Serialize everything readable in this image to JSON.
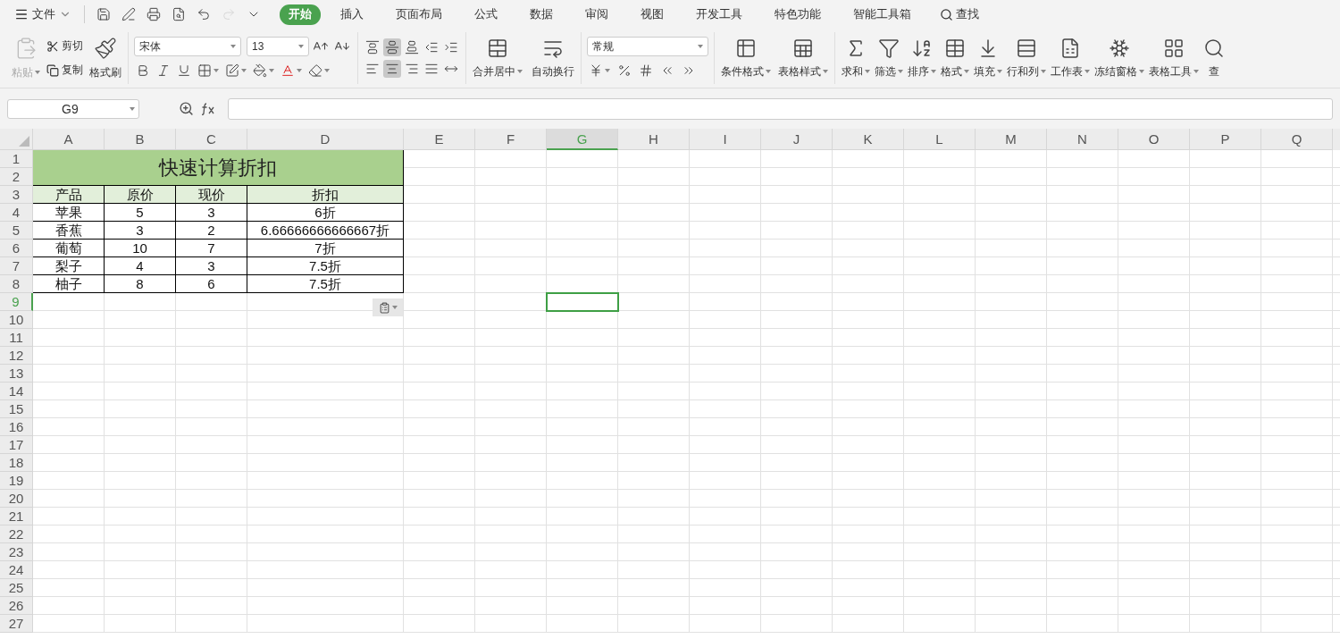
{
  "menu": {
    "label": "文件"
  },
  "quick_access": [
    {
      "disabled": false
    },
    {
      "disabled": false
    },
    {
      "disabled": false
    },
    {
      "disabled": false
    },
    {
      "disabled": false
    },
    {
      "disabled": true
    },
    {
      "disabled": false
    }
  ],
  "tabs": [
    {
      "label": "开始",
      "selected": true
    },
    {
      "label": "插入",
      "selected": false
    },
    {
      "label": "页面布局",
      "selected": false
    },
    {
      "label": "公式",
      "selected": false
    },
    {
      "label": "数据",
      "selected": false
    },
    {
      "label": "审阅",
      "selected": false
    },
    {
      "label": "视图",
      "selected": false
    },
    {
      "label": "开发工具",
      "selected": false
    },
    {
      "label": "特色功能",
      "selected": false
    },
    {
      "label": "智能工具箱",
      "selected": false
    }
  ],
  "search": {
    "label": "查找"
  },
  "clipboard": {
    "paste": {
      "label": "粘贴",
      "disabled": true
    },
    "cut": {
      "label": "剪切"
    },
    "copy": {
      "label": "复制"
    },
    "painter": {
      "label": "格式刷"
    }
  },
  "font": {
    "family": "宋体",
    "size": "13",
    "tools": [
      {
        "dropdown": false
      },
      {
        "dropdown": false
      },
      {
        "dropdown": false
      },
      {
        "dropdown": true
      },
      {
        "dropdown": true
      },
      {
        "dropdown": true
      },
      {
        "dropdown": true
      },
      {
        "dropdown": true
      }
    ]
  },
  "align": [
    {
      "selected": false
    },
    {
      "selected": true
    },
    {
      "selected": false
    },
    {
      "selected": false
    },
    {
      "selected": false
    },
    {
      "selected": false
    },
    {
      "selected": true
    },
    {
      "selected": false
    },
    {
      "selected": false
    },
    {
      "selected": false
    }
  ],
  "large_buttons_1": [
    {
      "label": "合并居中",
      "dropdown": true
    },
    {
      "label": "自动换行",
      "dropdown": false
    }
  ],
  "number": {
    "format": "常规",
    "tools": [
      {
        "dropdown": true
      },
      {
        "dropdown": false
      },
      {
        "dropdown": false
      },
      {
        "dropdown": false
      },
      {
        "dropdown": false
      }
    ]
  },
  "large_buttons_2": [
    {
      "label": "条件格式",
      "dropdown": true
    },
    {
      "label": "表格样式",
      "dropdown": true
    }
  ],
  "large_buttons_3": [
    {
      "label": "求和",
      "dropdown": true
    },
    {
      "label": "筛选",
      "dropdown": true
    },
    {
      "label": "排序",
      "dropdown": true
    },
    {
      "label": "格式",
      "dropdown": true
    },
    {
      "label": "填充",
      "dropdown": true
    },
    {
      "label": "行和列",
      "dropdown": true
    },
    {
      "label": "工作表",
      "dropdown": true
    },
    {
      "label": "冻结窗格",
      "dropdown": true
    },
    {
      "label": "表格工具",
      "dropdown": true
    },
    {
      "label": "查",
      "dropdown": false
    }
  ],
  "formula_bar": {
    "name_box": "G9"
  },
  "sheet": {
    "columns": [
      {
        "label": "A",
        "selected": false
      },
      {
        "label": "B",
        "selected": false
      },
      {
        "label": "C",
        "selected": false
      },
      {
        "label": "D",
        "selected": false
      },
      {
        "label": "E",
        "selected": false
      },
      {
        "label": "F",
        "selected": false
      },
      {
        "label": "G",
        "selected": true
      },
      {
        "label": "H",
        "selected": false
      },
      {
        "label": "I",
        "selected": false
      },
      {
        "label": "J",
        "selected": false
      },
      {
        "label": "K",
        "selected": false
      },
      {
        "label": "L",
        "selected": false
      },
      {
        "label": "M",
        "selected": false
      },
      {
        "label": "N",
        "selected": false
      },
      {
        "label": "O",
        "selected": false
      },
      {
        "label": "P",
        "selected": false
      },
      {
        "label": "Q",
        "selected": false
      }
    ],
    "rows": [
      {
        "label": "1",
        "selected": false
      },
      {
        "label": "2",
        "selected": false
      },
      {
        "label": "3",
        "selected": false
      },
      {
        "label": "4",
        "selected": false
      },
      {
        "label": "5",
        "selected": false
      },
      {
        "label": "6",
        "selected": false
      },
      {
        "label": "7",
        "selected": false
      },
      {
        "label": "8",
        "selected": false
      },
      {
        "label": "9",
        "selected": true
      },
      {
        "label": "10",
        "selected": false
      },
      {
        "label": "11",
        "selected": false
      },
      {
        "label": "12",
        "selected": false
      },
      {
        "label": "13",
        "selected": false
      },
      {
        "label": "14",
        "selected": false
      },
      {
        "label": "15",
        "selected": false
      },
      {
        "label": "16",
        "selected": false
      },
      {
        "label": "17",
        "selected": false
      },
      {
        "label": "18",
        "selected": false
      },
      {
        "label": "19",
        "selected": false
      },
      {
        "label": "20",
        "selected": false
      },
      {
        "label": "21",
        "selected": false
      },
      {
        "label": "22",
        "selected": false
      },
      {
        "label": "23",
        "selected": false
      },
      {
        "label": "24",
        "selected": false
      },
      {
        "label": "25",
        "selected": false
      },
      {
        "label": "26",
        "selected": false
      },
      {
        "label": "27",
        "selected": false
      }
    ],
    "title": "快速计算折扣",
    "header": [
      "产品",
      "原价",
      "现价",
      "折扣"
    ],
    "data": [
      [
        "苹果",
        "5",
        "3",
        "6折"
      ],
      [
        "香蕉",
        "3",
        "2",
        "6.66666666666667折"
      ],
      [
        "葡萄",
        "10",
        "7",
        "7折"
      ],
      [
        "梨子",
        "4",
        "3",
        "7.5折"
      ],
      [
        "柚子",
        "8",
        "6",
        "7.5折"
      ]
    ]
  }
}
